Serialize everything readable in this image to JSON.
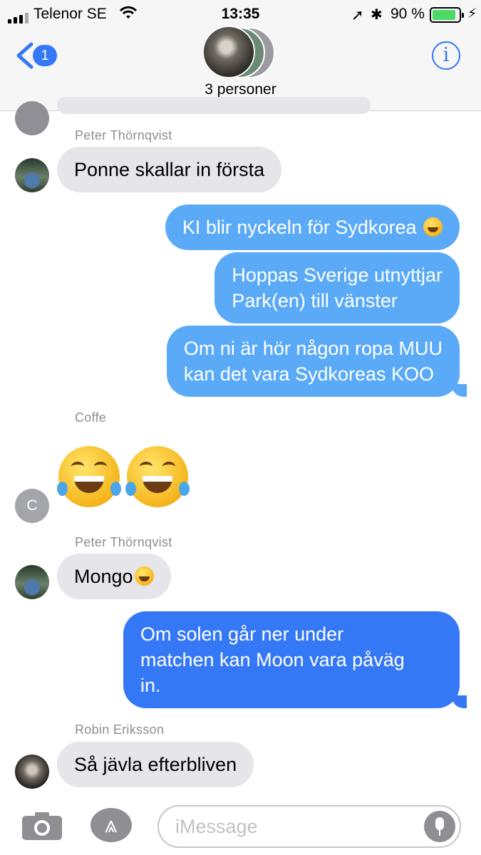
{
  "status_bar": {
    "carrier": "Telenor SE",
    "time": "13:35",
    "battery_percent": "90 %",
    "battery_level": 0.9
  },
  "nav": {
    "back_badge": "1",
    "group_name": "3 personer",
    "info_label": "i"
  },
  "messages": [
    {
      "sender": "Peter Thörnqvist",
      "text": "Ponne skallar in första",
      "direction": "incoming"
    },
    {
      "text": "KI blir nyckeln för Sydkorea",
      "emoji": "tears-of-joy",
      "direction": "outgoing",
      "type": "sms"
    },
    {
      "text_lines": [
        "Hoppas Sverige utnyttjar",
        "Park(en) till vänster"
      ],
      "direction": "outgoing",
      "type": "sms"
    },
    {
      "text_lines": [
        "Om ni är hör någon ropa MUU",
        "kan det vara Sydkoreas KOO"
      ],
      "direction": "outgoing",
      "type": "sms"
    },
    {
      "sender": "Coffe",
      "emoji": [
        "tears-of-joy",
        "tears-of-joy"
      ],
      "avatar_initial": "C",
      "direction": "incoming"
    },
    {
      "sender": "Peter Thörnqvist",
      "text": "Mongo",
      "emoji": "grinning",
      "direction": "incoming"
    },
    {
      "text_lines": [
        "Om solen går ner under",
        "matchen kan Moon vara påväg",
        "in."
      ],
      "direction": "outgoing",
      "type": "imessage"
    },
    {
      "sender": "Robin Eriksson",
      "text": "Så jävla efterbliven",
      "direction": "incoming"
    }
  ],
  "compose": {
    "placeholder": "iMessage"
  },
  "colors": {
    "sms": "#5aaaf7",
    "imessage": "#3478f6",
    "incoming": "#e5e5ea",
    "accent": "#3478f6"
  }
}
